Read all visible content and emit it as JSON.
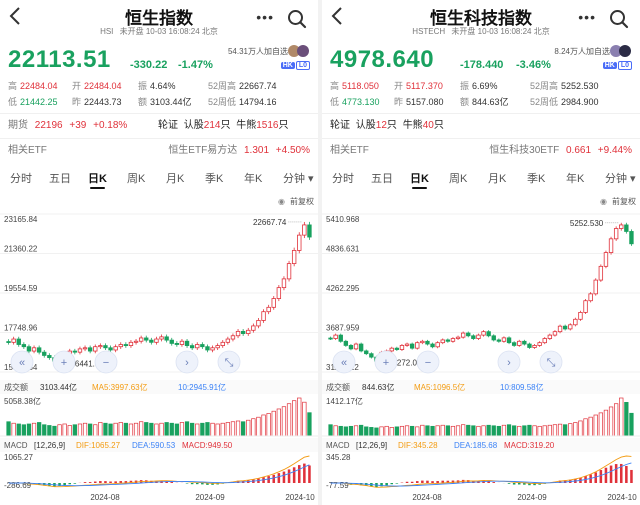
{
  "tabs": [
    "分时",
    "五日",
    "日K",
    "周K",
    "月K",
    "季K",
    "年K",
    "分钟"
  ],
  "common": {
    "more_icon": "•••",
    "adjust": "前复权",
    "vol_label": "成交额",
    "macd_label": "MACD",
    "macd_params": "[12,26,9]",
    "x_labels": [
      "2024-08",
      "2024-09",
      "2024-10"
    ],
    "colors": {
      "up": "#e0313a",
      "down": "#19a15f",
      "ma5": "#f39c12",
      "ma10": "#3b82f6",
      "dif": "#f39c12",
      "dea": "#3b82f6"
    }
  },
  "panels": [
    {
      "title": "恒生指数",
      "code": "HSI",
      "status": "未开盘 10-03 16:08:24 北京",
      "price": "22113.51",
      "change": "-330.22",
      "pct": "-1.47%",
      "fans": "54.31万人加自选",
      "stats": [
        [
          {
            "k": "高",
            "v": "22484.04",
            "c": "red"
          },
          {
            "k": "开",
            "v": "22484.04",
            "c": "red"
          },
          {
            "k": "振",
            "v": "4.64%",
            "c": ""
          },
          {
            "k": "52周高",
            "v": "22667.74",
            "c": ""
          }
        ],
        [
          {
            "k": "低",
            "v": "21442.25",
            "c": "green"
          },
          {
            "k": "昨",
            "v": "22443.73",
            "c": ""
          },
          {
            "k": "额",
            "v": "3103.44亿",
            "c": ""
          },
          {
            "k": "52周低",
            "v": "14794.16",
            "c": ""
          }
        ]
      ],
      "futures": {
        "label": "期货",
        "value": "22196",
        "chg": "+39",
        "pct": "+0.18%"
      },
      "warrants": {
        "label": "轮证",
        "text1": "认股",
        "n1": "214",
        "unit1": "只",
        "text2": "牛熊",
        "n2": "1516",
        "unit2": "只"
      },
      "etf": {
        "label": "相关ETF",
        "name": "恒生ETF易方达",
        "value": "1.301",
        "pct": "+4.50%"
      },
      "chart_data": {
        "type": "candlestick",
        "y_ticks": [
          "23165.84",
          "21360.22",
          "19554.59",
          "17748.96",
          "15943.34"
        ],
        "ylim": [
          15943.34,
          23165.84
        ],
        "high_label": "22667.74",
        "low_label": "16441.44",
        "vol_total": "3103.44亿",
        "ma5": "MA5:3997.63亿",
        "ma10": "10:2945.91亿",
        "vol_max": "5058.38亿",
        "dif": "DIF:1065.27",
        "dea": "DEA:590.53",
        "macd": "MACD:949.50",
        "macd_max": "1065.27",
        "macd_min": "-286.69",
        "closes": [
          17300,
          17450,
          17200,
          17100,
          16900,
          17050,
          16850,
          16700,
          16600,
          16441,
          16750,
          16800,
          16900,
          16850,
          17000,
          17050,
          16900,
          17100,
          17150,
          17050,
          16950,
          17100,
          17200,
          17150,
          17300,
          17350,
          17500,
          17400,
          17300,
          17450,
          17550,
          17400,
          17250,
          17200,
          17350,
          17150,
          17050,
          17200,
          17100,
          16950,
          17050,
          17150,
          17300,
          17450,
          17600,
          17800,
          17700,
          17850,
          18050,
          18300,
          18700,
          18900,
          19300,
          19800,
          20200,
          20900,
          21500,
          22200,
          22667,
          22113
        ],
        "vols": [
          1900,
          1700,
          1600,
          1500,
          1600,
          1700,
          1800,
          1500,
          1400,
          1300,
          1500,
          1600,
          1400,
          1500,
          1600,
          1700,
          1600,
          1500,
          1800,
          1700,
          1600,
          1700,
          1800,
          1700,
          1600,
          1700,
          1900,
          1800,
          1700,
          1600,
          1700,
          1800,
          1700,
          1600,
          1800,
          1900,
          1700,
          1600,
          1700,
          1800,
          1700,
          1600,
          1700,
          1800,
          1900,
          2000,
          1900,
          2100,
          2300,
          2500,
          2800,
          3000,
          3300,
          3600,
          3900,
          4300,
          4700,
          5058,
          4500,
          3103
        ]
      }
    },
    {
      "title": "恒生科技指数",
      "code": "HSTECH",
      "status": "未开盘 10-03 16:08:24 北京",
      "price": "4978.640",
      "change": "-178.440",
      "pct": "-3.46%",
      "fans": "8.24万人加自选",
      "stats": [
        [
          {
            "k": "高",
            "v": "5118.050",
            "c": "red"
          },
          {
            "k": "开",
            "v": "5117.370",
            "c": "red"
          },
          {
            "k": "振",
            "v": "6.69%",
            "c": ""
          },
          {
            "k": "52周高",
            "v": "5252.530",
            "c": ""
          }
        ],
        [
          {
            "k": "低",
            "v": "4773.130",
            "c": "green"
          },
          {
            "k": "昨",
            "v": "5157.080",
            "c": ""
          },
          {
            "k": "额",
            "v": "844.63亿",
            "c": ""
          },
          {
            "k": "52周低",
            "v": "2984.900",
            "c": ""
          }
        ]
      ],
      "futures": null,
      "warrants": {
        "label": "轮证",
        "text1": "认股",
        "n1": "12",
        "unit1": "只",
        "text2": "牛熊",
        "n2": "40",
        "unit2": "只"
      },
      "etf": {
        "label": "相关ETF",
        "name": "恒生科技30ETF",
        "value": "0.661",
        "pct": "+9.44%"
      },
      "chart_data": {
        "type": "candlestick",
        "y_ticks": [
          "5410.968",
          "4836.631",
          "4262.295",
          "3687.959",
          "3113.622"
        ],
        "ylim": [
          3113.622,
          5410.968
        ],
        "high_label": "5252.530",
        "low_label": "3272.060",
        "vol_total": "844.63亿",
        "ma5": "MA5:1096.5亿",
        "ma10": "10:809.58亿",
        "vol_max": "1412.17亿",
        "dif": "DIF:345.28",
        "dea": "DEA:185.68",
        "macd": "MACD:319.20",
        "macd_max": "345.28",
        "macd_min": "-77.59",
        "closes": [
          3600,
          3650,
          3560,
          3500,
          3450,
          3520,
          3420,
          3380,
          3330,
          3272,
          3400,
          3420,
          3460,
          3440,
          3500,
          3520,
          3460,
          3540,
          3560,
          3520,
          3480,
          3540,
          3580,
          3560,
          3600,
          3620,
          3680,
          3640,
          3600,
          3650,
          3700,
          3640,
          3580,
          3560,
          3610,
          3540,
          3500,
          3560,
          3520,
          3470,
          3500,
          3540,
          3600,
          3650,
          3700,
          3780,
          3740,
          3800,
          3880,
          3980,
          4150,
          4250,
          4450,
          4650,
          4850,
          5050,
          5200,
          5252,
          5157,
          4978
        ],
        "vols": [
          420,
          380,
          360,
          340,
          360,
          380,
          400,
          340,
          320,
          300,
          340,
          360,
          320,
          340,
          360,
          380,
          360,
          340,
          400,
          380,
          360,
          380,
          400,
          380,
          360,
          380,
          420,
          400,
          380,
          360,
          380,
          400,
          380,
          360,
          400,
          420,
          380,
          360,
          380,
          400,
          380,
          360,
          380,
          400,
          420,
          440,
          420,
          460,
          500,
          560,
          640,
          700,
          780,
          860,
          960,
          1080,
          1200,
          1412,
          1250,
          845
        ]
      }
    }
  ]
}
